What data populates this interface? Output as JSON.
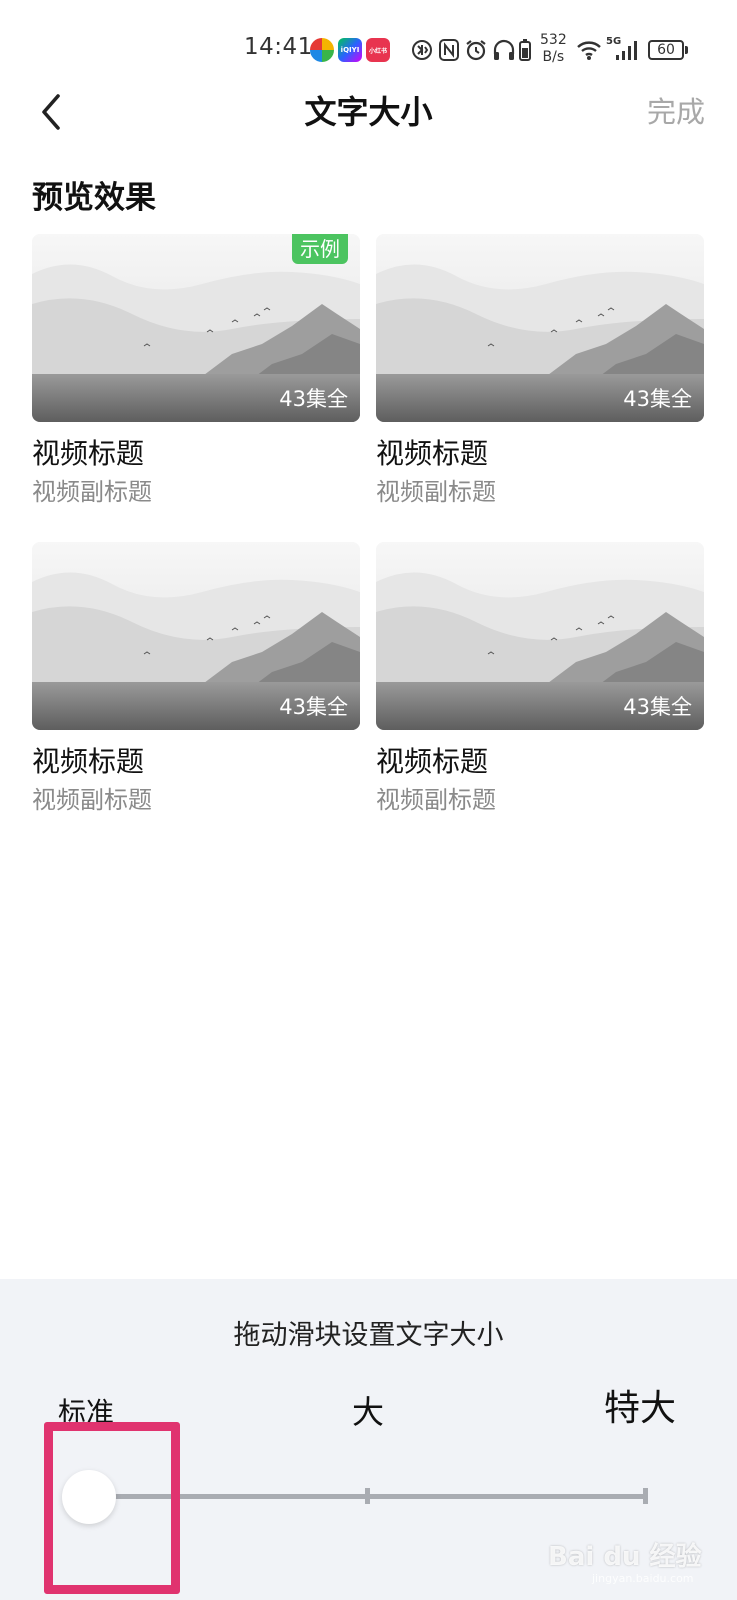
{
  "status_bar": {
    "time": "14:41",
    "network_speed_value": "532",
    "network_speed_unit": "B/s",
    "signal_type": "5G",
    "battery": "60",
    "app_icon_iqiyi": "iQIYI",
    "app_icon_xiaohongshu": "小红书"
  },
  "nav": {
    "title": "文字大小",
    "done_label": "完成"
  },
  "preview": {
    "section_title": "预览效果",
    "sample_badge": "示例",
    "cards": [
      {
        "title": "视频标题",
        "subtitle": "视频副标题",
        "episodes": "43集全"
      },
      {
        "title": "视频标题",
        "subtitle": "视频副标题",
        "episodes": "43集全"
      },
      {
        "title": "视频标题",
        "subtitle": "视频副标题",
        "episodes": "43集全"
      },
      {
        "title": "视频标题",
        "subtitle": "视频副标题",
        "episodes": "43集全"
      }
    ]
  },
  "font_size_panel": {
    "hint": "拖动滑块设置文字大小",
    "levels": [
      "标准",
      "大",
      "特大"
    ],
    "selected_level": "标准",
    "selected_index": 0
  },
  "watermark": {
    "brand": "Bai du 经验",
    "url": "jingyan.baidu.com"
  },
  "colors": {
    "badge_green": "#4cc460",
    "highlight_pink": "#e0336f",
    "panel_bg": "#f1f3f7"
  }
}
